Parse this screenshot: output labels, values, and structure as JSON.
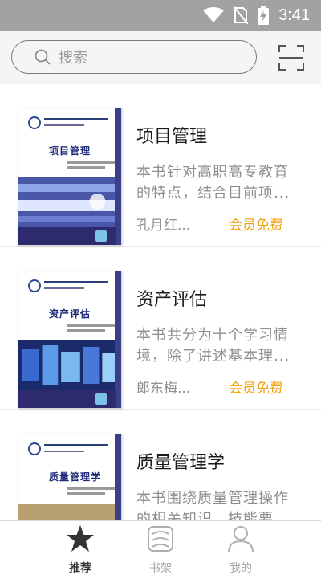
{
  "status_bar": {
    "time": "3:41"
  },
  "search": {
    "placeholder": "搜索"
  },
  "books": [
    {
      "title": "项目管理",
      "cover_title": "项目管理",
      "description": "本书针对高职高专教育的特点，结合目前项...",
      "author": "孔月红...",
      "price": "会员免费"
    },
    {
      "title": "资产评估",
      "cover_title": "资产评估",
      "description": "本书共分为十个学习情境，除了讲述基本理...",
      "author": "郎东梅...",
      "price": "会员免费"
    },
    {
      "title": "质量管理学",
      "cover_title": "质量管理学",
      "description": "本书围绕质量管理操作的相关知识、技能要",
      "author": "",
      "price": ""
    }
  ],
  "tabs": [
    {
      "label": "推荐",
      "icon": "star-icon",
      "active": true
    },
    {
      "label": "书架",
      "icon": "bookshelf-icon",
      "active": false
    },
    {
      "label": "我的",
      "icon": "person-icon",
      "active": false
    }
  ],
  "colors": {
    "price": "#f0a010",
    "status_bar": "#a2a2a2",
    "header": "#f5f5f5"
  }
}
